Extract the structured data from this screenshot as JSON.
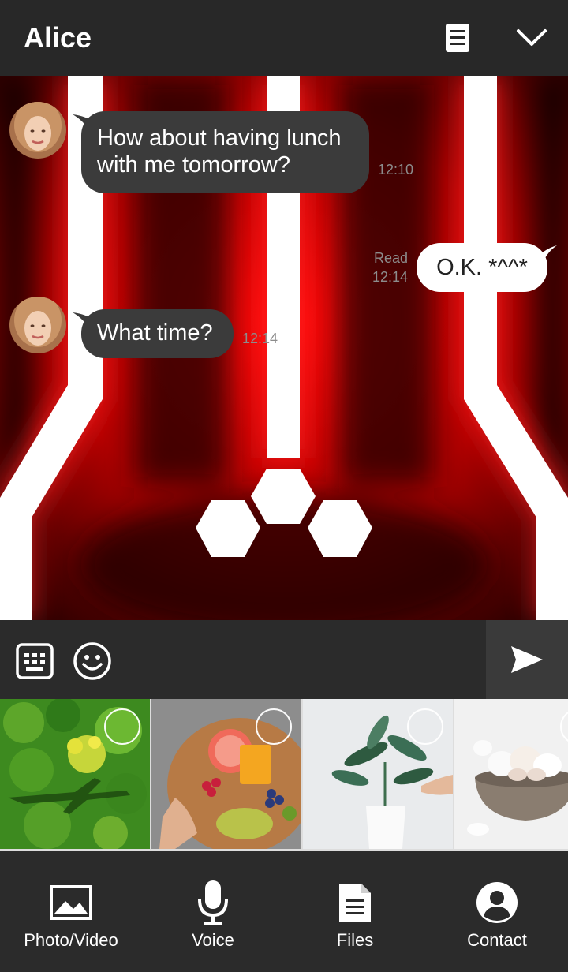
{
  "header": {
    "title": "Alice",
    "notes_icon": "notes-icon",
    "collapse_icon": "chevron-down-icon"
  },
  "messages": [
    {
      "direction": "incoming",
      "sender": "Alice",
      "lines": [
        "How about having lunch",
        "with me tomorrow?"
      ],
      "time": "12:10"
    },
    {
      "direction": "outgoing",
      "text": "O.K. *^^*",
      "status": "Read",
      "time": "12:14"
    },
    {
      "direction": "incoming",
      "sender": "Alice",
      "text": "What time?",
      "time": "12:14"
    }
  ],
  "input_bar": {
    "keyboard_icon": "keyboard-icon",
    "emoji_icon": "smiley-icon",
    "send_icon": "send-icon"
  },
  "gallery": {
    "items": [
      "forest-aerial-photo",
      "fruit-platter-photo",
      "plant-vase-photo",
      "garlic-bowl-photo"
    ]
  },
  "tabs": [
    {
      "label": "Photo/Video",
      "icon": "image-icon"
    },
    {
      "label": "Voice",
      "icon": "microphone-icon"
    },
    {
      "label": "Files",
      "icon": "file-icon"
    },
    {
      "label": "Contact",
      "icon": "contact-icon"
    }
  ],
  "colors": {
    "header_bg": "#282828",
    "theme_red": "#e00000",
    "bubble_incoming": "#3b3b3b",
    "bubble_outgoing": "#ffffff",
    "tab_bar_bg": "#2b2b2b"
  }
}
